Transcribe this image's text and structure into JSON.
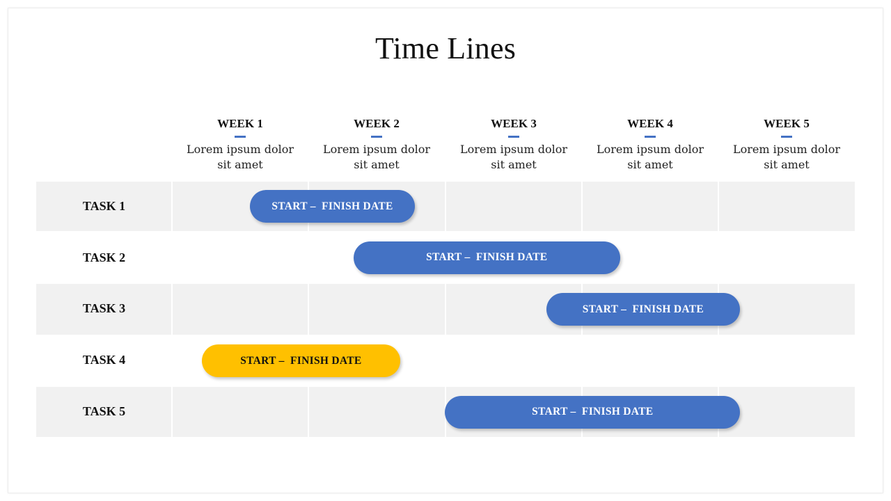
{
  "title": "Time Lines",
  "colors": {
    "accent_blue": "#4472C4",
    "accent_yellow": "#FFC000",
    "row_gray": "#F1F1F1",
    "text_dark": "#111111",
    "bar_text_light": "#FFFFFF"
  },
  "weeks": [
    {
      "label": "WEEK 1",
      "desc_line1": "Lorem ipsum dolor",
      "desc_line2": "sit amet"
    },
    {
      "label": "WEEK 2",
      "desc_line1": "Lorem ipsum dolor",
      "desc_line2": "sit amet"
    },
    {
      "label": "WEEK 3",
      "desc_line1": "Lorem ipsum dolor",
      "desc_line2": "sit amet"
    },
    {
      "label": "WEEK 4",
      "desc_line1": "Lorem ipsum dolor",
      "desc_line2": "sit amet"
    },
    {
      "label": "WEEK 5",
      "desc_line1": "Lorem ipsum dolor",
      "desc_line2": "sit amet"
    }
  ],
  "tasks": [
    {
      "label": "TASK 1",
      "bar_label": "START –  FINISH DATE",
      "start_week": 0.57,
      "end_week": 1.78,
      "color": "blue"
    },
    {
      "label": "TASK 2",
      "bar_label": "START –  FINISH DATE",
      "start_week": 1.33,
      "end_week": 3.28,
      "color": "blue"
    },
    {
      "label": "TASK 3",
      "bar_label": "START –  FINISH DATE",
      "start_week": 2.74,
      "end_week": 4.16,
      "color": "blue"
    },
    {
      "label": "TASK 4",
      "bar_label": "START –  FINISH DATE",
      "start_week": 0.22,
      "end_week": 1.67,
      "color": "yellow"
    },
    {
      "label": "TASK 5",
      "bar_label": "START –  FINISH DATE",
      "start_week": 2.0,
      "end_week": 4.16,
      "color": "blue"
    }
  ]
}
